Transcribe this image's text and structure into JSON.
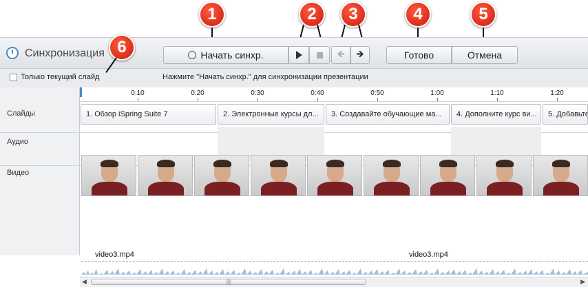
{
  "panel": {
    "title": "Синхронизация",
    "buttons": {
      "start_sync": "Начать синхр.",
      "done": "Готово",
      "cancel": "Отмена"
    },
    "checkbox_label": "Только текущий слайд",
    "checkbox_checked": false,
    "hint": "Нажмите \"Начать синхр.\" для синхронизации презентации"
  },
  "callouts": [
    "1",
    "2",
    "3",
    "4",
    "5",
    "6"
  ],
  "timeline": {
    "ruler": [
      "0:10",
      "0:20",
      "0:30",
      "0:40",
      "0:50",
      "1:00",
      "1:10",
      "1:20"
    ],
    "tracks": {
      "slides": "Слайды",
      "audio": "Аудио",
      "video": "Видео"
    },
    "slides": [
      "1. Обзор iSpring Suite 7",
      "2. Электронные курсы дл...",
      "3. Создавайте обучающие ма...",
      "4. Дополните курс ви...",
      "5. Добавьте"
    ],
    "video_files": [
      "video3.mp4",
      "video3.mp4"
    ]
  },
  "colors": {
    "accent": "#4a8bc4",
    "callout": "#d9231a",
    "video_shirt": "#7a1f22"
  },
  "icons": [
    "stopwatch-icon",
    "play-icon",
    "stop-icon",
    "arrow-left-icon",
    "arrow-right-icon",
    "checkbox"
  ]
}
